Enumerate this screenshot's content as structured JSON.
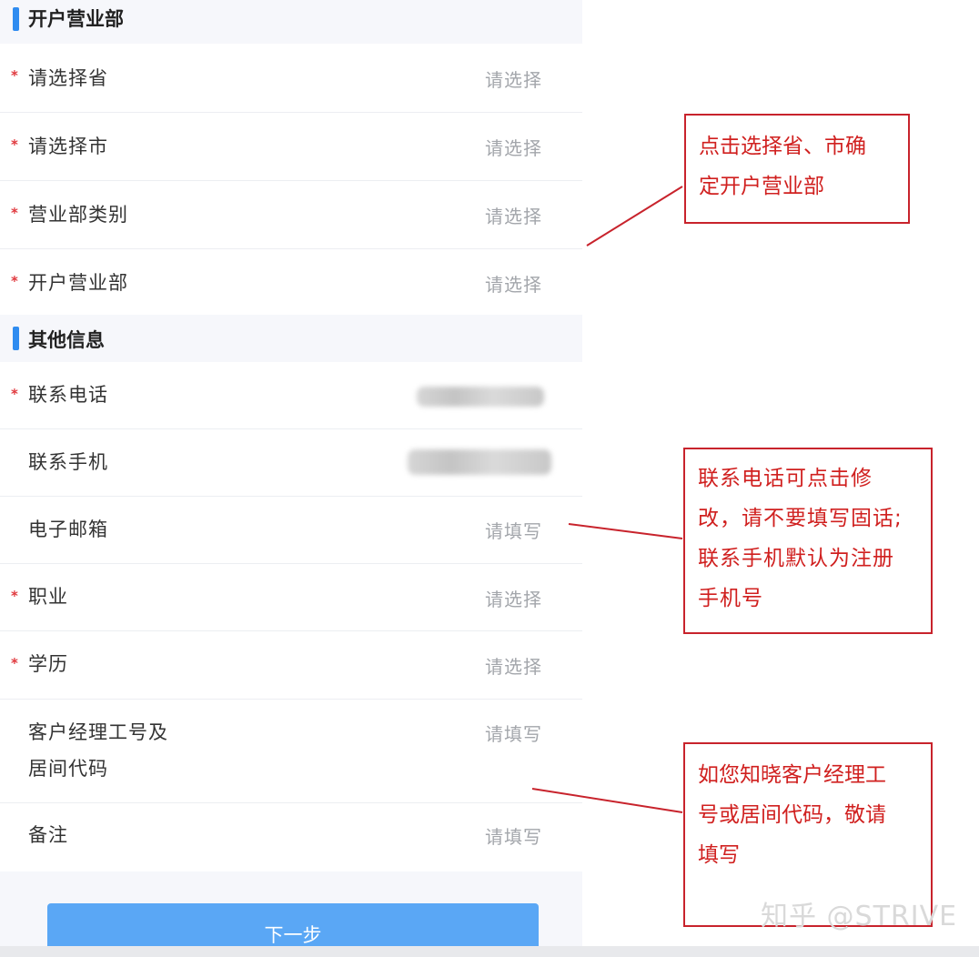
{
  "sections": {
    "branch": "开户营业部",
    "other": "其他信息"
  },
  "fields": {
    "province": {
      "label": "请选择省",
      "value": "请选择"
    },
    "city": {
      "label": "请选择市",
      "value": "请选择"
    },
    "branch_type": {
      "label": "营业部类别",
      "value": "请选择"
    },
    "branch": {
      "label": "开户营业部",
      "value": "请选择"
    },
    "phone": {
      "label": "联系电话"
    },
    "mobile": {
      "label": "联系手机"
    },
    "email": {
      "label": "电子邮箱",
      "value": "请填写"
    },
    "occupation": {
      "label": "职业",
      "value": "请选择"
    },
    "education": {
      "label": "学历",
      "value": "请选择"
    },
    "manager_code": {
      "label_line1": "客户经理工号及",
      "label_line2": "居间代码",
      "value": "请填写"
    },
    "remark": {
      "label": "备注",
      "value": "请填写"
    }
  },
  "next_button": "下一步",
  "annotations": {
    "note1": [
      "点击选择省、市确",
      "定开户营业部"
    ],
    "note2": [
      "联系电话可点击修",
      "改，请不要填写固话;",
      "联系手机默认为注册",
      "手机号"
    ],
    "note3": [
      "如您知晓客户经理工",
      "号或居间代码，敬请",
      "填写"
    ]
  },
  "watermark": "知乎 @STRIVE",
  "colors": {
    "accent": "#2f8cf0",
    "required": "#e0393e",
    "annotation": "#d0201f",
    "button": "#5aa7f5"
  }
}
